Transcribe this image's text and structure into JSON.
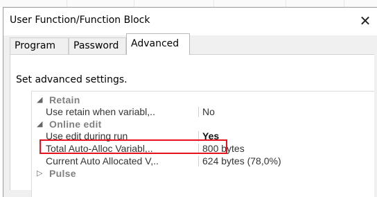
{
  "window": {
    "title": "User Function/Function Block",
    "close_glyph": "✕"
  },
  "tabs": [
    {
      "label": "Program"
    },
    {
      "label": "Password"
    },
    {
      "label": "Advanced",
      "active": true
    }
  ],
  "panel": {
    "heading": "Set advanced settings."
  },
  "properties": {
    "retain": {
      "label": "Retain",
      "glyph": "◢",
      "rows": [
        {
          "name": "Use retain when variabl,..",
          "value": "No"
        }
      ]
    },
    "online_edit": {
      "label": "Online edit",
      "glyph": "◢",
      "rows": [
        {
          "name": "Use edit during run",
          "value": "Yes"
        },
        {
          "name": "Total Auto-Alloc Variabl,..",
          "value": "800 bytes"
        },
        {
          "name": "Current Auto Allocated V,..",
          "value": "624 bytes (78,0%)"
        }
      ]
    },
    "pulse": {
      "label": "Pulse",
      "glyph": "▷"
    }
  },
  "colors": {
    "highlight": "#e8121c",
    "category_text": "#808080"
  }
}
